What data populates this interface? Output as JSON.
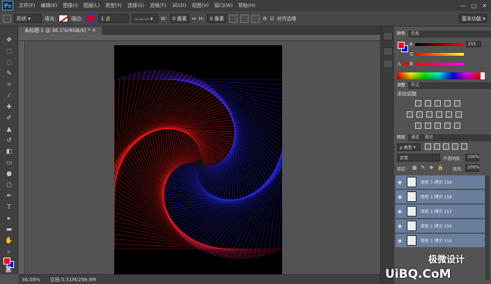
{
  "app": {
    "logo": "Ps"
  },
  "menu": [
    "文件(F)",
    "编辑(E)",
    "图像(I)",
    "图层(L)",
    "类型(Y)",
    "选择(S)",
    "滤镜(T)",
    "3D(D)",
    "视图(V)",
    "窗口(W)",
    "帮助(H)"
  ],
  "window_controls": [
    "—",
    "□",
    "✕"
  ],
  "options": {
    "shape_mode": "形状",
    "fill_label": "填充:",
    "stroke_label": "描边:",
    "stroke_width": "1 点",
    "w_label": "W:",
    "w_value": "0 像素",
    "h_label": "H:",
    "h_value": "0 像素",
    "align_edges": "对齐边缘",
    "workspace": "基本功能"
  },
  "document": {
    "tab_title": "未标题-1 @ 36.1%(RGB/8) *",
    "close": "✕"
  },
  "status": {
    "zoom": "36.08%",
    "doc_size": "文档:5.51M/298.9M"
  },
  "color_panel": {
    "tabs": [
      "颜色",
      "色板"
    ],
    "r_label": "R",
    "r_value": "255",
    "g_label": "G",
    "g_value": "",
    "b_label": "B",
    "b_value": "",
    "fg_color": "#ff0000",
    "bg_color": "#0000ff"
  },
  "adjust_panel": {
    "tabs": [
      "调整",
      "样式"
    ],
    "title": "添加调整"
  },
  "layers_panel": {
    "tabs": [
      "图层",
      "通道",
      "路径"
    ],
    "filter": "ρ 类型",
    "blend_mode": "正常",
    "opacity_label": "不透明度:",
    "opacity_value": "100%",
    "lock_label": "锁定:",
    "fill_label": "填充:",
    "fill_value": "100%",
    "layers": [
      {
        "name": "矩形 1 拷贝 159"
      },
      {
        "name": "矩形 1 拷贝 158"
      },
      {
        "name": "矩形 1 拷贝 157"
      },
      {
        "name": "矩形 1 拷贝 156"
      },
      {
        "name": "矩形 1 拷贝 155"
      }
    ]
  },
  "watermark": {
    "text1": "极微设计",
    "text2": "UiBQ.CoM"
  },
  "art": {
    "blue": "#2a2cff",
    "red": "#ff1a1a",
    "center": "#111111"
  }
}
